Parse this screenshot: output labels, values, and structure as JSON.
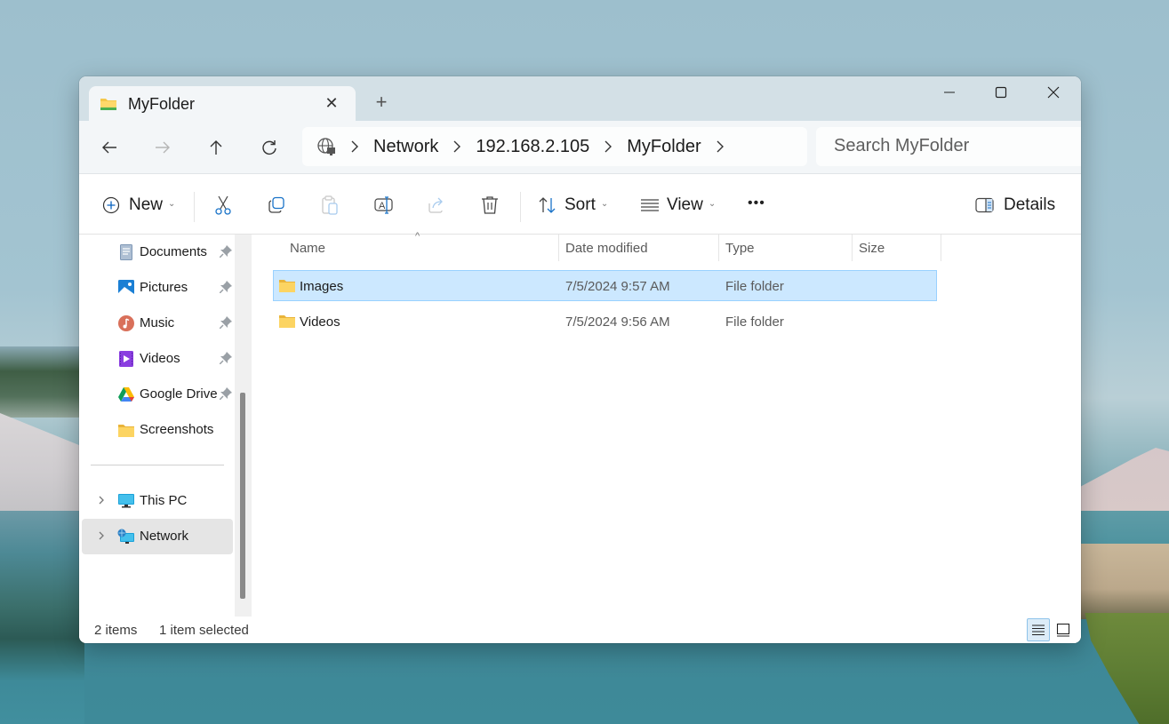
{
  "window": {
    "tab_title": "MyFolder",
    "tab_icon": "folder-icon",
    "controls": [
      "minimize",
      "maximize",
      "close"
    ]
  },
  "navigation": {
    "back_enabled": true,
    "forward_enabled": false,
    "breadcrumb": [
      "Network",
      "192.168.2.105",
      "MyFolder"
    ],
    "breadcrumb_root_icon": "network-globe-icon",
    "search_placeholder": "Search MyFolder"
  },
  "toolbar": {
    "new_label": "New",
    "sort_label": "Sort",
    "view_label": "View",
    "more_label": "•••",
    "details_label": "Details",
    "actions": [
      {
        "name": "cut",
        "enabled": true
      },
      {
        "name": "copy",
        "enabled": true
      },
      {
        "name": "paste",
        "enabled": false
      },
      {
        "name": "rename",
        "enabled": true
      },
      {
        "name": "share",
        "enabled": false
      },
      {
        "name": "delete",
        "enabled": true
      }
    ]
  },
  "sidebar": {
    "quick_access": [
      {
        "label": "Documents",
        "icon": "documents-icon",
        "pinned": true
      },
      {
        "label": "Pictures",
        "icon": "pictures-icon",
        "pinned": true
      },
      {
        "label": "Music",
        "icon": "music-icon",
        "pinned": true
      },
      {
        "label": "Videos",
        "icon": "videos-icon",
        "pinned": true
      },
      {
        "label": "Google Drive",
        "icon": "google-drive-icon",
        "pinned": true
      },
      {
        "label": "Screenshots",
        "icon": "folder-icon",
        "pinned": false
      }
    ],
    "locations": [
      {
        "label": "This PC",
        "icon": "computer-icon",
        "active": false
      },
      {
        "label": "Network",
        "icon": "network-icon",
        "active": true
      }
    ]
  },
  "file_list": {
    "columns": [
      "Name",
      "Date modified",
      "Type",
      "Size"
    ],
    "sorted_by": "Name",
    "rows": [
      {
        "name": "Images",
        "date": "7/5/2024 9:57 AM",
        "type": "File folder",
        "size": "",
        "selected": true
      },
      {
        "name": "Videos",
        "date": "7/5/2024 9:56 AM",
        "type": "File folder",
        "size": "",
        "selected": false
      }
    ]
  },
  "status": {
    "item_count": "2 items",
    "selection": "1 item selected",
    "active_view": "details"
  }
}
